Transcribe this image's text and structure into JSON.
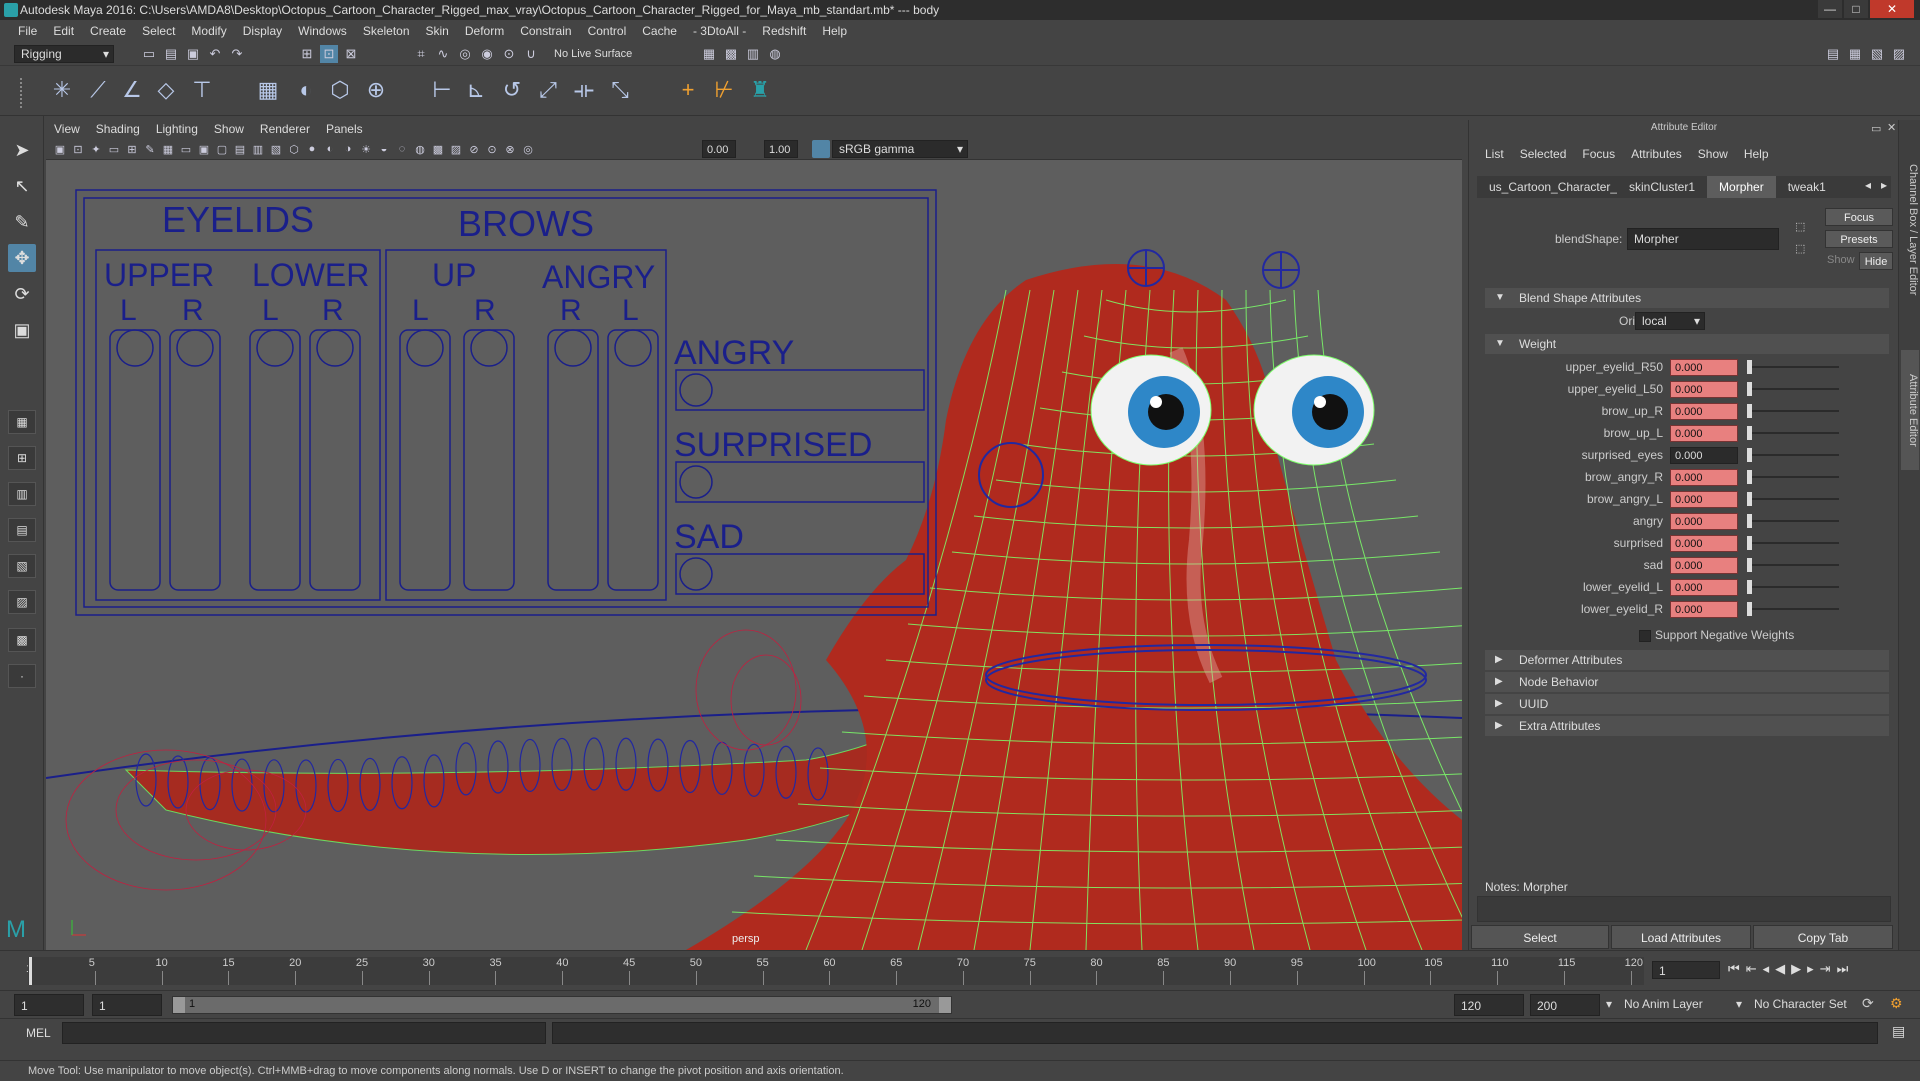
{
  "window": {
    "title": "Autodesk Maya 2016: C:\\Users\\AMDA8\\Desktop\\Octopus_Cartoon_Character_Rigged_max_vray\\Octopus_Cartoon_Character_Rigged_for_Maya_mb_standart.mb*   ---   body",
    "minimize": "—",
    "maximize": "□",
    "close": "✕"
  },
  "menu": [
    "File",
    "Edit",
    "Create",
    "Select",
    "Modify",
    "Display",
    "Windows",
    "Skeleton",
    "Skin",
    "Deform",
    "Constrain",
    "Control",
    "Cache",
    "- 3DtoAll -",
    "Redshift",
    "Help"
  ],
  "status_line": {
    "menu_set": "Rigging",
    "live_surface": "No Live Surface"
  },
  "viewport": {
    "menu": [
      "View",
      "Shading",
      "Lighting",
      "Show",
      "Renderer",
      "Panels"
    ],
    "field_a": "0.00",
    "field_b": "1.00",
    "color_space": "sRGB gamma",
    "camera": "persp"
  },
  "face_ui": {
    "eyelids": "EYELIDS",
    "brows": "BROWS",
    "upper": "UPPER",
    "lower": "LOWER",
    "up": "UP",
    "angry_col": "ANGRY",
    "l": "L",
    "r": "R",
    "angry": "ANGRY",
    "surprised": "SURPRISED",
    "sad": "SAD"
  },
  "attribute_editor": {
    "title": "Attribute Editor",
    "menu": [
      "List",
      "Selected",
      "Focus",
      "Attributes",
      "Show",
      "Help"
    ],
    "tabs": [
      "us_Cartoon_Character_Rigged",
      "skinCluster1",
      "Morpher",
      "tweak1"
    ],
    "active_tab": "Morpher",
    "blendshape_label": "blendShape:",
    "blendshape_value": "Morpher",
    "focus_btn": "Focus",
    "presets_btn": "Presets",
    "show_label": "Show",
    "hide_btn": "Hide",
    "section_blend": "Blend Shape Attributes",
    "origin_label": "Origin",
    "origin_value": "local",
    "section_weight": "Weight",
    "weights": [
      {
        "name": "upper_eyelid_R50",
        "value": "0.000",
        "keyed": true
      },
      {
        "name": "upper_eyelid_L50",
        "value": "0.000",
        "keyed": true
      },
      {
        "name": "brow_up_R",
        "value": "0.000",
        "keyed": true
      },
      {
        "name": "brow_up_L",
        "value": "0.000",
        "keyed": true
      },
      {
        "name": "surprised_eyes",
        "value": "0.000",
        "keyed": false
      },
      {
        "name": "brow_angry_R",
        "value": "0.000",
        "keyed": true
      },
      {
        "name": "brow_angry_L",
        "value": "0.000",
        "keyed": true
      },
      {
        "name": "angry",
        "value": "0.000",
        "keyed": true
      },
      {
        "name": "surprised",
        "value": "0.000",
        "keyed": true
      },
      {
        "name": "sad",
        "value": "0.000",
        "keyed": true
      },
      {
        "name": "lower_eyelid_L",
        "value": "0.000",
        "keyed": true
      },
      {
        "name": "lower_eyelid_R",
        "value": "0.000",
        "keyed": true
      }
    ],
    "support_negative": "Support Negative Weights",
    "sections": [
      "Deformer Attributes",
      "Node Behavior",
      "UUID",
      "Extra Attributes"
    ],
    "notes_label": "Notes:  Morpher",
    "btn_select": "Select",
    "btn_load": "Load Attributes",
    "btn_copy": "Copy Tab"
  },
  "side_tabs": [
    "Channel Box / Layer Editor",
    "Attribute Editor"
  ],
  "timeline": {
    "ticks": [
      "5",
      "10",
      "15",
      "20",
      "25",
      "30",
      "35",
      "40",
      "45",
      "50",
      "55",
      "60",
      "65",
      "70",
      "75",
      "80",
      "85",
      "90",
      "95",
      "100",
      "105",
      "110",
      "115",
      "120"
    ],
    "start_tick": "1",
    "current_frame": "1"
  },
  "range": {
    "start": "1",
    "anim_start": "1",
    "range_start": "1",
    "range_end": "120",
    "anim_end": "120",
    "end": "200",
    "anim_layer": "No Anim Layer",
    "char_set": "No Character Set"
  },
  "command": {
    "lang": "MEL"
  },
  "help_line": "Move Tool: Use manipulator to move object(s). Ctrl+MMB+drag to move components along normals. Use D or INSERT to change the pivot position and axis orientation.",
  "colors": {
    "accent": "#5285a6",
    "keyed_field": "#e8807f",
    "octopus_red": "#b02a1e",
    "wire_green": "#7dff6a",
    "control_blue": "#1a1f8a"
  }
}
